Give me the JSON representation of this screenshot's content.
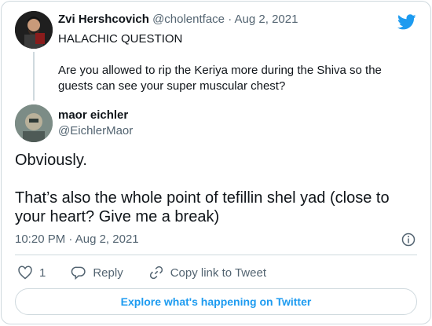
{
  "parent_tweet": {
    "name": "Zvi Hershcovich",
    "handle": "@cholentface",
    "separator": "·",
    "date": "Aug 2, 2021",
    "line1": "HALACHIC QUESTION",
    "line2": "Are you allowed to rip the Keriya more during the Shiva so the guests can see your super muscular chest?"
  },
  "reply_tweet": {
    "name": "maor eichler",
    "handle": "@EichlerMaor",
    "paragraph1": "Obviously.",
    "paragraph2": "That’s also the whole point of tefillin shel yad (close to your heart? Give me a break)",
    "time": "10:20 PM",
    "separator": "·",
    "date": "Aug 2, 2021"
  },
  "actions": {
    "like_count": "1",
    "reply_label": "Reply",
    "copy_label": "Copy link to Tweet"
  },
  "explore_label": "Explore what's happening on Twitter",
  "colors": {
    "brand": "#1d9bf0",
    "muted": "#536471",
    "border": "#cfd9de"
  },
  "icons": [
    "twitter-bird-icon",
    "info-icon",
    "heart-icon",
    "reply-icon",
    "link-icon"
  ]
}
